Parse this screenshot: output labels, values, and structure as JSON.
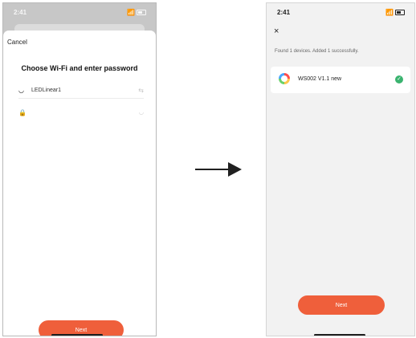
{
  "left_screen": {
    "status_time": "2:41",
    "status_icons": "📶 ",
    "cancel": "Cancel",
    "title": "Choose Wi-Fi and enter password",
    "wifi_name": "LEDLinear1",
    "next": "Next",
    "icons": {
      "wifi": "wifi-icon",
      "lock": "lock-icon",
      "eye": "eye-icon",
      "arrow": "arrow-icon"
    }
  },
  "right_screen": {
    "status_time": "2:41",
    "status_icons": "📶 ",
    "found_text": "Found 1 devices. Added 1 successfully.",
    "device_name": "WS002 V1.1 new",
    "next": "Next",
    "icons": {
      "close": "close-icon",
      "device": "device-logo-icon",
      "success": "success-check-icon"
    }
  },
  "colors": {
    "accent": "#ef5f3b",
    "success": "#3ab36f"
  }
}
